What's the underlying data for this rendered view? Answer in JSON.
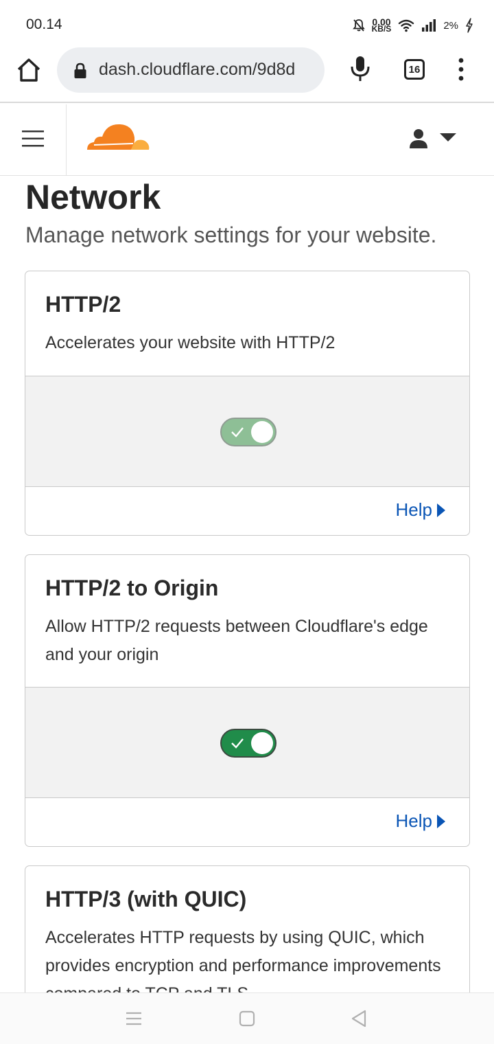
{
  "status": {
    "time": "00.14",
    "net_speed_value": "0.00",
    "net_speed_unit": "KB/S",
    "battery": "2%"
  },
  "browser": {
    "url": "dash.cloudflare.com/9d8d",
    "tab_count": "16"
  },
  "page": {
    "title": "Network",
    "subtitle": "Manage network settings for your website."
  },
  "cards": [
    {
      "title": "HTTP/2",
      "description": "Accelerates your website with HTTP/2",
      "toggle": "on",
      "help": "Help"
    },
    {
      "title": "HTTP/2 to Origin",
      "description": "Allow HTTP/2 requests between Cloudflare's edge and your origin",
      "toggle": "on",
      "help": "Help"
    },
    {
      "title": "HTTP/3 (with QUIC)",
      "description": "Accelerates HTTP requests by using QUIC, which provides encryption and performance improvements compared to TCP and TLS"
    }
  ],
  "colors": {
    "accent_link": "#0a55b5",
    "toggle_on": "#208c4a",
    "toggle_disabled": "#8ebf96",
    "brand_orange": "#f48120"
  },
  "icons": {
    "home": "home-icon",
    "lock": "lock-icon",
    "mic": "mic-icon",
    "menu": "hamburger-menu-icon",
    "user": "user-icon",
    "help_arrow": "triangle-right-icon"
  }
}
